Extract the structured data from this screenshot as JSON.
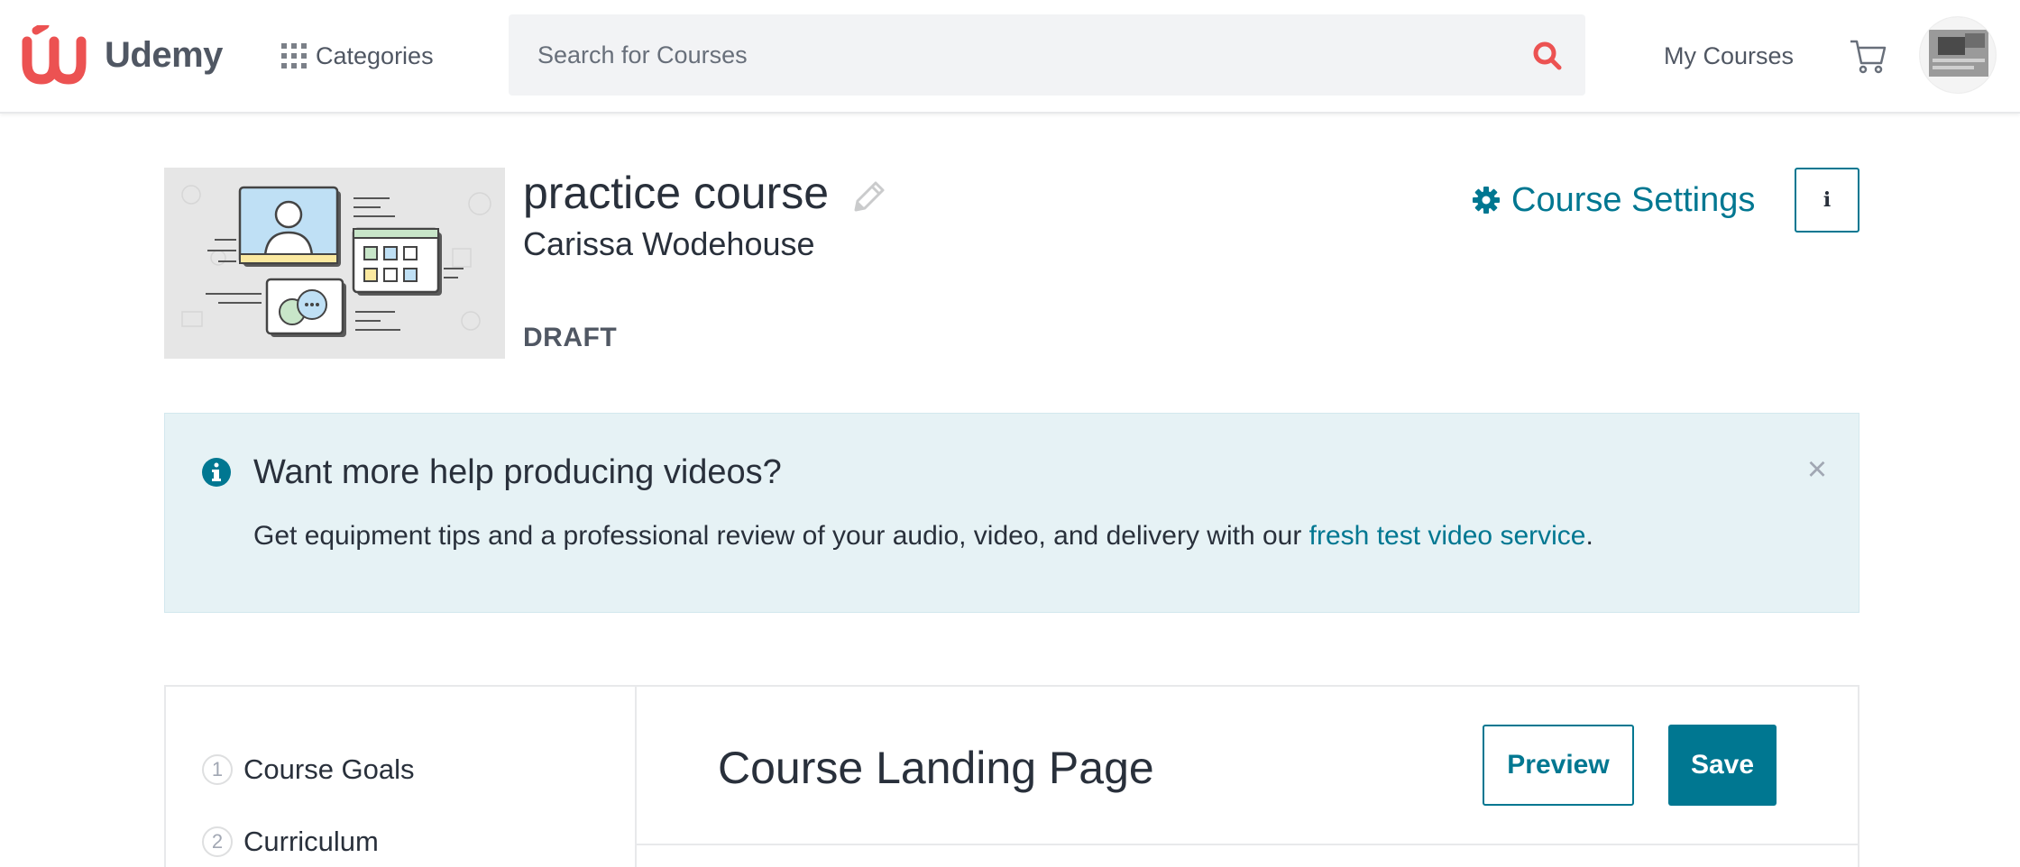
{
  "header": {
    "brand": "Udemy",
    "categories_label": "Categories",
    "search_placeholder": "Search for Courses",
    "my_courses_label": "My Courses",
    "accent_color": "#ec5252"
  },
  "course": {
    "title": "practice course",
    "instructor": "Carissa Wodehouse",
    "status": "DRAFT",
    "settings_label": "Course Settings",
    "info_label": "i"
  },
  "alert": {
    "title": "Want more help producing videos?",
    "body_text": "Get equipment tips and a professional review of your audio, video, and delivery with our ",
    "link_text": "fresh test video service",
    "body_end": ".",
    "close_label": "×"
  },
  "sidebar": {
    "items": [
      {
        "number": "1",
        "label": "Course Goals"
      },
      {
        "number": "2",
        "label": "Curriculum"
      }
    ]
  },
  "main": {
    "heading": "Course Landing Page",
    "preview_label": "Preview",
    "save_label": "Save"
  },
  "colors": {
    "primary": "#007791",
    "alert_bg": "#e6f2f5",
    "text": "#29303b"
  }
}
